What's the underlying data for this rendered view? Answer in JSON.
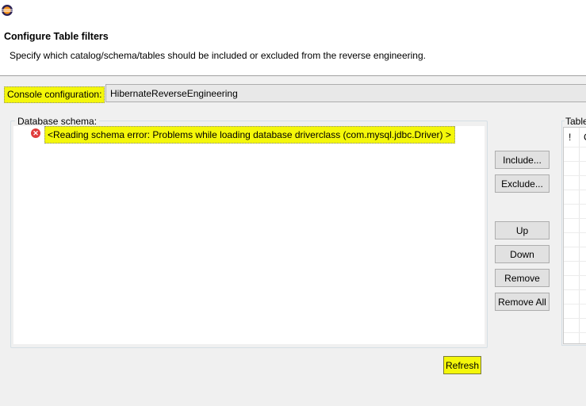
{
  "window": {
    "icon": "eclipse-icon"
  },
  "header": {
    "title": "Configure Table filters",
    "description": "Specify which catalog/schema/tables should be included or excluded from the reverse engineering."
  },
  "console": {
    "label": "Console configuration:",
    "value": "HibernateReverseEngineering"
  },
  "schema": {
    "legend": "Database schema:",
    "error_icon": "error-icon",
    "error_text": "<Reading schema error: Problems while loading database driverclass (com.mysql.jdbc.Driver) >"
  },
  "buttons": {
    "include": "Include...",
    "exclude": "Exclude...",
    "up": "Up",
    "down": "Down",
    "remove": "Remove",
    "remove_all": "Remove All",
    "refresh": "Refresh"
  },
  "table_filters": {
    "legend": "Table",
    "col1": "!",
    "col2": "C"
  },
  "colors": {
    "highlight": "#f4f70a",
    "error": "#e03c3c"
  }
}
